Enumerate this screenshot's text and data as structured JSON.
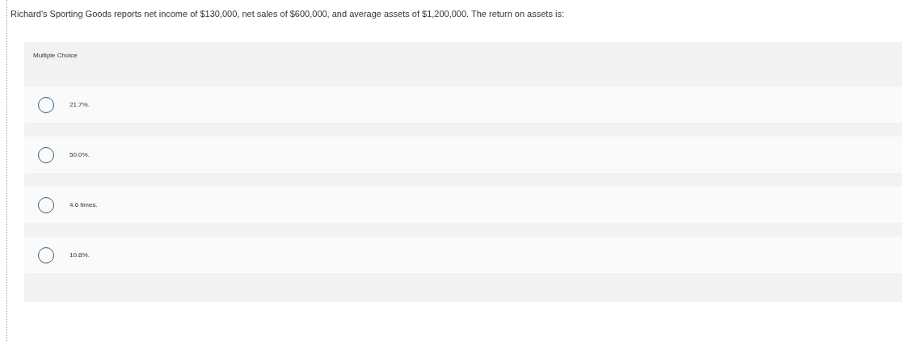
{
  "question": "Richard's Sporting Goods reports net income of $130,000, net sales of $600,000, and average assets of $1,200,000. The return on assets is:",
  "answer_section": {
    "heading": "Multiple Choice",
    "choices": [
      {
        "label": "21.7%.",
        "selected": false
      },
      {
        "label": "50.0%.",
        "selected": false
      },
      {
        "label": "4.6 times.",
        "selected": false
      },
      {
        "label": "10.8%.",
        "selected": false
      }
    ]
  }
}
